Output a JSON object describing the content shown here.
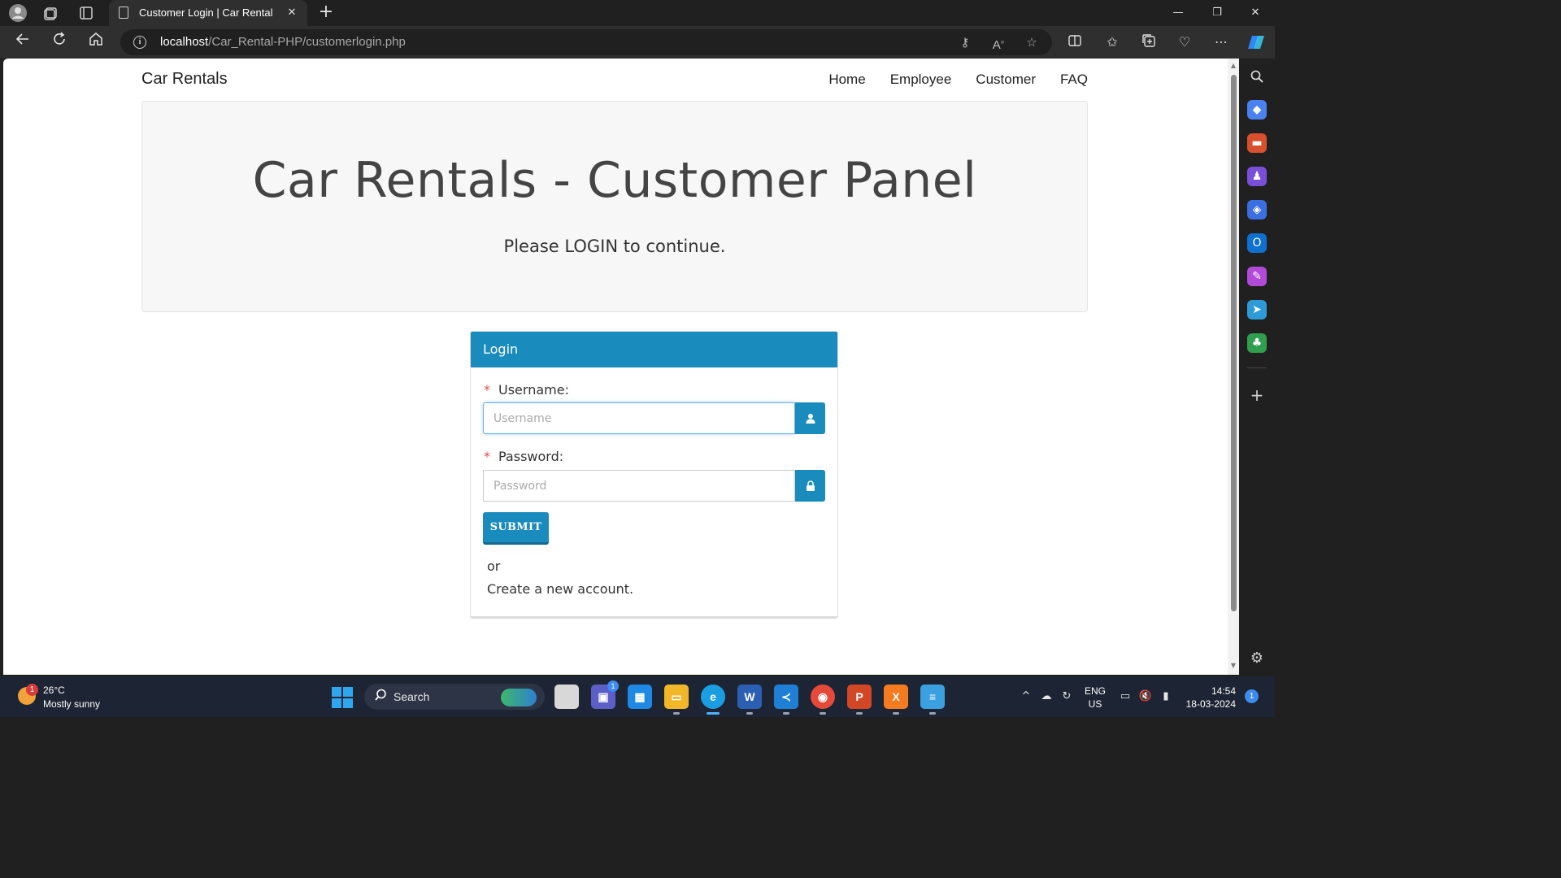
{
  "browser": {
    "tab_title": "Customer Login | Car Rental",
    "close_tab_glyph": "✕",
    "new_tab_glyph": "+",
    "url_host": "localhost",
    "url_path": "/Car_Rental-PHP/customerlogin.php",
    "window_controls": {
      "minimize": "—",
      "restore": "❐",
      "close": "✕"
    }
  },
  "page": {
    "brand": "Car Rentals",
    "nav": [
      "Home",
      "Employee",
      "Customer",
      "FAQ"
    ],
    "hero": {
      "title": "Car Rentals - Customer Panel",
      "subtitle": "Please LOGIN to continue."
    },
    "login_panel": {
      "header": "Login",
      "required_mark": "*",
      "username_label": "Username:",
      "username_placeholder": "Username",
      "username_icon": "user-icon",
      "password_label": "Password:",
      "password_placeholder": "Password",
      "password_icon": "lock-icon",
      "submit_label": "SUBMIT",
      "or_text": "or",
      "create_account_text": "Create a new account."
    }
  },
  "taskbar": {
    "weather_temp": "26°C",
    "weather_desc": "Mostly sunny",
    "weather_badge": "1",
    "search_label": "Search",
    "teams_badge": "1",
    "word_letter": "W",
    "lang_line1": "ENG",
    "lang_line2": "US",
    "time": "14:54",
    "date": "18-03-2024",
    "notification_count": "1"
  },
  "colors": {
    "primary": "#1a8bbd",
    "required": "#d9534f",
    "hero_bg": "#f7f7f7",
    "browser_dark": "#202020",
    "taskbar": "#1d2433"
  }
}
